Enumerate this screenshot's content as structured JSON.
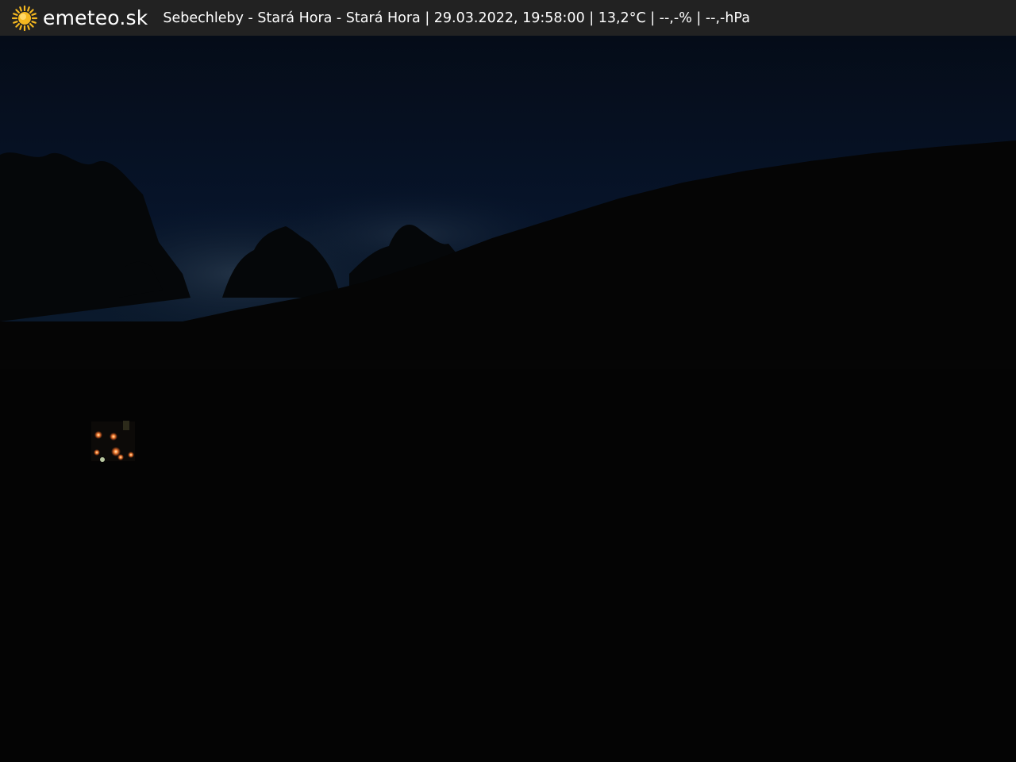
{
  "header": {
    "brand": "emeteo.sk",
    "station_info": "Sebechleby - Stará Hora - Stará Hora | 29.03.2022, 19:58:00 | 13,2°C | --,-% | --,-hPa",
    "logo_icon": "sun-icon",
    "logo_color": "#f5b820",
    "bar_color": "#222222"
  },
  "scene": {
    "sky_color": "#06111f",
    "ground_color": "#040404"
  }
}
